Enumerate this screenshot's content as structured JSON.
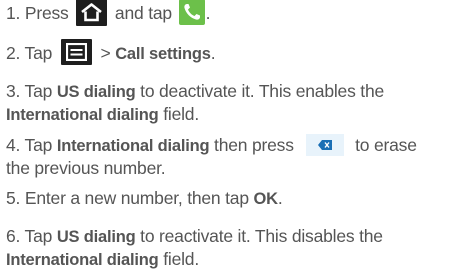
{
  "steps": [
    {
      "number": "1.",
      "text_before": " Press ",
      "text_middle": " and tap ",
      "text_end": ".",
      "icons": [
        "home-icon",
        "phone-icon"
      ]
    },
    {
      "number": "2.",
      "text_before": " Tap ",
      "separator": " > ",
      "bold_label": "Call settings",
      "text_end": ".",
      "icons": [
        "menu-icon"
      ]
    },
    {
      "number": "3.",
      "text_before": " Tap ",
      "bold_1": "US dialing",
      "text_middle": " to deactivate it. This enables the",
      "bold_2": "International dialing",
      "text_end": " field."
    },
    {
      "number": "4.",
      "text_before": " Tap ",
      "bold_1": "International dialing",
      "text_middle": " then press ",
      "text_after_icon": " to erase",
      "text_line2": "the previous number.",
      "icons": [
        "backspace-icon"
      ]
    },
    {
      "number": "5.",
      "text_before": " Enter a new number, then tap ",
      "bold_1": "OK",
      "text_end": "."
    },
    {
      "number": "6.",
      "text_before": " Tap ",
      "bold_1": "US dialing",
      "text_middle": " to reactivate it. This disables the",
      "bold_2": "International dialing",
      "text_end": " field."
    }
  ],
  "colors": {
    "text": "#555555",
    "icon_dark": "#1e1e1e",
    "phone_green": "#6cc04a",
    "backspace_bg": "#e8f3fb",
    "backspace_key": "#1a6fb5"
  }
}
